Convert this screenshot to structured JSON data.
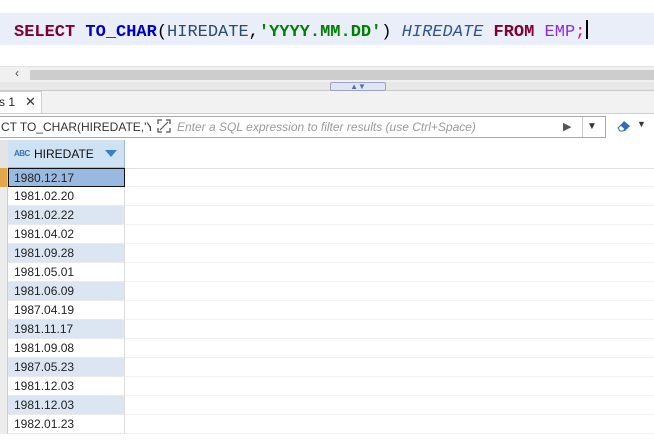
{
  "editor": {
    "sql": {
      "kw_select": "SELECT",
      "fn": "TO_CHAR",
      "open_paren": "(",
      "col": "HIREDATE",
      "comma": ",",
      "fmt": "'YYYY.MM.DD'",
      "close_paren": ")",
      "alias": "HIREDATE",
      "kw_from": "FROM",
      "table": "EMP",
      "semicolon": ";"
    }
  },
  "results_tab": {
    "label": "s 1",
    "close_glyph": "✕"
  },
  "filter_bar": {
    "query_text": "CT TO_CHAR(HIREDATE,'YYYY",
    "placeholder": "Enter a SQL expression to filter results (use Ctrl+Space)"
  },
  "grid": {
    "column": {
      "type_badge": "ABC",
      "name": "HIREDATE"
    },
    "rows": [
      "1980.12.17",
      "1981.02.20",
      "1981.02.22",
      "1981.04.02",
      "1981.09.28",
      "1981.05.01",
      "1981.06.09",
      "1987.04.19",
      "1981.11.17",
      "1981.09.08",
      "1987.05.23",
      "1981.12.03",
      "1981.12.03",
      "1982.01.23"
    ],
    "selected_row_index": 0
  },
  "colors": {
    "keyword": "#7f0033",
    "function": "#0000c0",
    "string": "#008000",
    "selection": "#9ab9e0",
    "header": "#cfe2f3"
  }
}
